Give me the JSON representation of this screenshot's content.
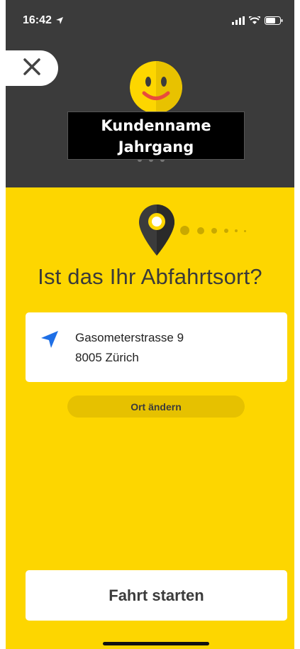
{
  "status": {
    "time": "16:42"
  },
  "header": {
    "name_line1": "Kundenname",
    "name_line2": "Jahrgang"
  },
  "main": {
    "question": "Ist das Ihr Abfahrtsort?",
    "address_line1": "Gasometerstrasse 9",
    "address_line2": "8005 Zürich",
    "change_label": "Ort ändern",
    "start_label": "Fahrt starten"
  },
  "colors": {
    "brand_yellow": "#FDD600",
    "header_dark": "#3B3B3B",
    "accent_blue": "#1E6FE6"
  }
}
